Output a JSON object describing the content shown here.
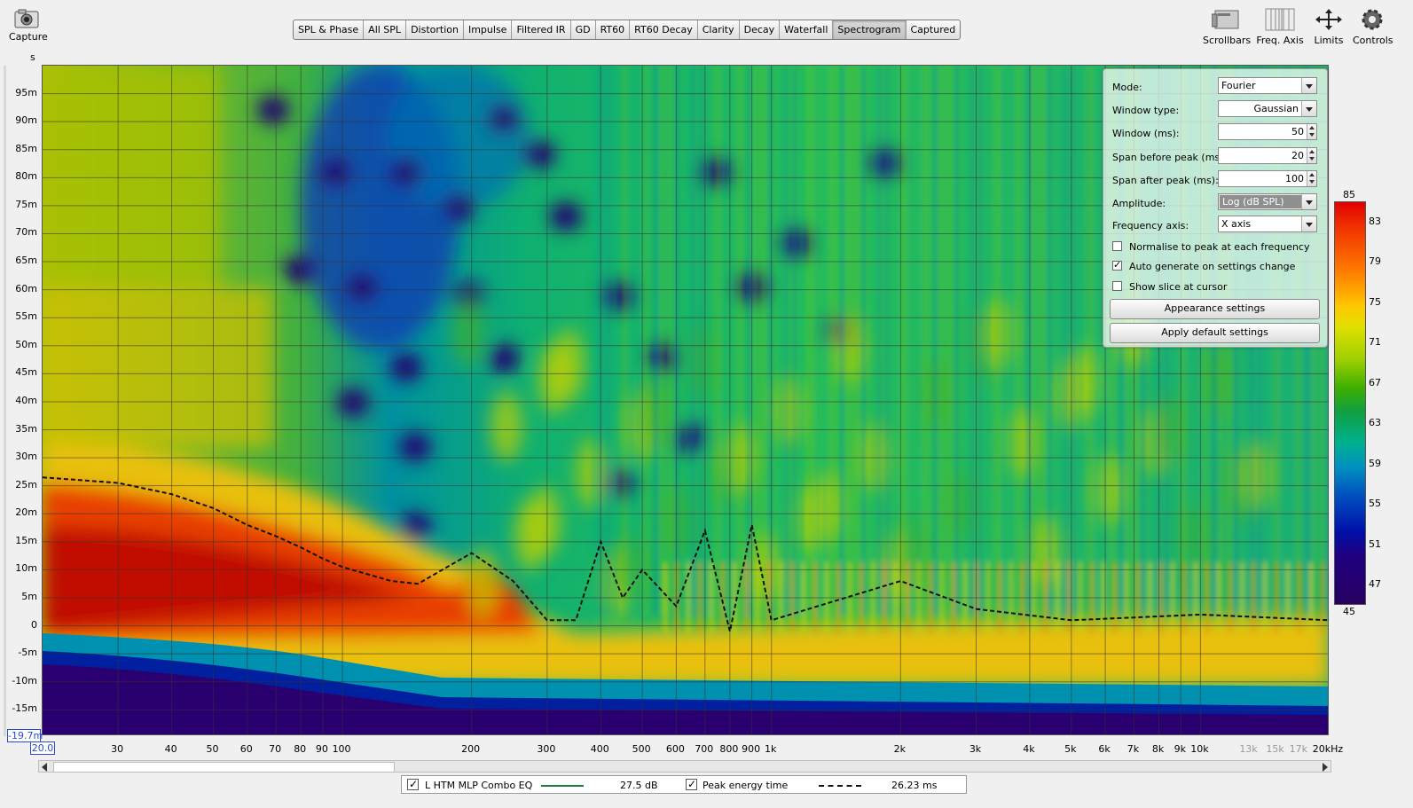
{
  "toolbar": {
    "capture_label": "Capture",
    "scrollbars_label": "Scrollbars",
    "freq_axis_label": "Freq. Axis",
    "limits_label": "Limits",
    "controls_label": "Controls"
  },
  "tabs": [
    "SPL & Phase",
    "All SPL",
    "Distortion",
    "Impulse",
    "Filtered IR",
    "GD",
    "RT60",
    "RT60 Decay",
    "Clarity",
    "Decay",
    "Waterfall",
    "Spectrogram",
    "Captured"
  ],
  "active_tab": "Spectrogram",
  "axis": {
    "y_unit": "s",
    "y_ticks": [
      "95m",
      "90m",
      "85m",
      "80m",
      "75m",
      "70m",
      "65m",
      "60m",
      "55m",
      "50m",
      "45m",
      "40m",
      "35m",
      "30m",
      "25m",
      "20m",
      "15m",
      "10m",
      "5m",
      "0",
      "-5m",
      "-10m",
      "-15m"
    ],
    "y_min_label": "-19.7m",
    "x_min_label": "20.0",
    "x_ticks": [
      "30",
      "40",
      "50",
      "60",
      "70",
      "80",
      "90",
      "100",
      "200",
      "300",
      "400",
      "500",
      "600",
      "700",
      "800",
      "900",
      "1k",
      "2k",
      "3k",
      "4k",
      "5k",
      "6k",
      "7k",
      "8k",
      "9k",
      "10k"
    ],
    "x_ticks_grey": [
      "13k",
      "15k",
      "17k"
    ],
    "x_max_label": "20kHz"
  },
  "panel": {
    "mode_label": "Mode:",
    "mode_value": "Fourier",
    "window_type_label": "Window type:",
    "window_type_value": "Gaussian",
    "window_ms_label": "Window (ms):",
    "window_ms_value": "50",
    "span_before_label": "Span before peak (ms):",
    "span_before_value": "20",
    "span_after_label": "Span after peak (ms):",
    "span_after_value": "100",
    "amplitude_label": "Amplitude:",
    "amplitude_value": "Log (dB SPL)",
    "freq_axis_label": "Frequency axis:",
    "freq_axis_value": "X axis",
    "normalise_label": "Normalise to peak at each frequency",
    "normalise_checked": false,
    "autogen_label": "Auto generate on settings change",
    "autogen_checked": true,
    "slice_label": "Show slice at cursor",
    "slice_checked": false,
    "appearance_button": "Appearance settings",
    "defaults_button": "Apply default settings"
  },
  "scale": {
    "labels": [
      "85",
      "83",
      "79",
      "75",
      "71",
      "67",
      "63",
      "59",
      "55",
      "51",
      "47",
      "45"
    ]
  },
  "legend": {
    "series1_name": "L HTM MLP Combo EQ",
    "series1_value": "27.5 dB",
    "series1_color": "#1a7a3a",
    "series2_name": "Peak energy time",
    "series2_value": "26.23 ms"
  },
  "chart_data": {
    "type": "heatmap",
    "xlabel": "",
    "ylabel": "s",
    "x_scale": "log",
    "xlim": [
      20,
      20000
    ],
    "ylim": [
      -0.0197,
      0.1
    ],
    "color_range_db": [
      45,
      85
    ],
    "series": [
      {
        "name": "Peak energy time",
        "x": [
          20,
          30,
          40,
          50,
          60,
          70,
          80,
          90,
          100,
          130,
          150,
          200,
          250,
          300,
          350,
          400,
          450,
          500,
          600,
          700,
          800,
          900,
          1000,
          2000,
          3000,
          5000,
          10000,
          20000
        ],
        "y": [
          0.0265,
          0.0255,
          0.0235,
          0.021,
          0.018,
          0.016,
          0.014,
          0.012,
          0.0105,
          0.008,
          0.0075,
          0.013,
          0.008,
          0.001,
          0.001,
          0.015,
          0.005,
          0.01,
          0.0035,
          0.017,
          -0.001,
          0.018,
          0.001,
          0.008,
          0.003,
          0.001,
          0.002,
          0.001
        ]
      }
    ]
  }
}
